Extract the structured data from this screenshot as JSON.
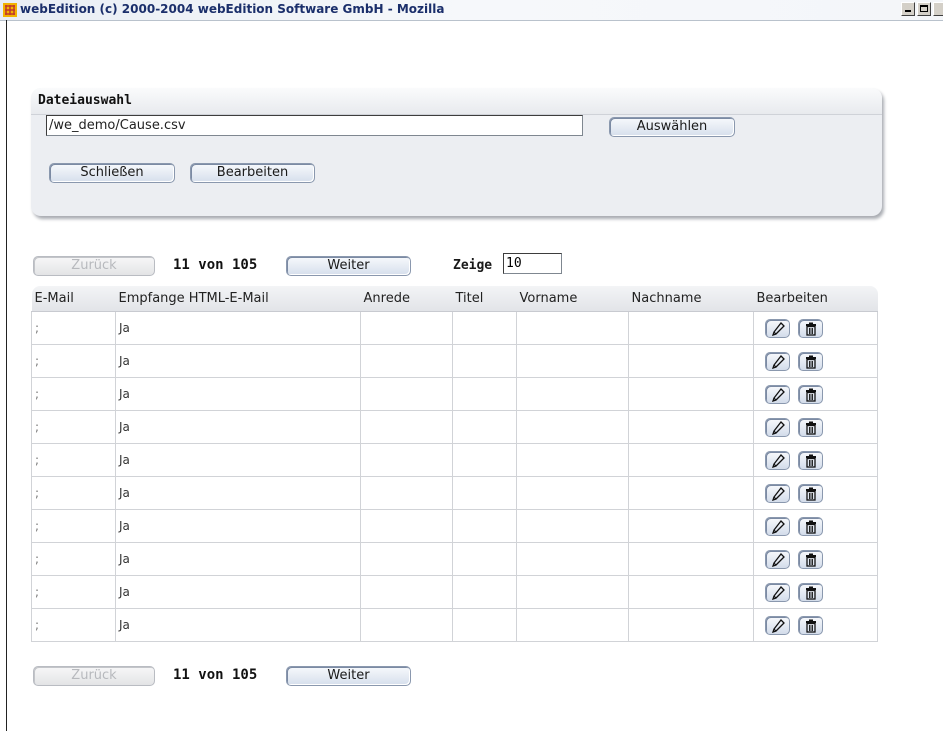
{
  "window": {
    "title": "webEdition (c) 2000-2004 webEdition Software GmbH - Mozilla",
    "app_icon": "webedition-logo-icon"
  },
  "file_selection": {
    "title": "Dateiauswahl",
    "path_value": "/we_demo/Cause.csv",
    "choose_label": "Auswählen",
    "close_label": "Schließen",
    "edit_label": "Bearbeiten"
  },
  "pager_top": {
    "prev_label": "Zurück",
    "count_text": "11 von 105",
    "next_label": "Weiter",
    "show_label": "Zeige",
    "show_value": "10"
  },
  "pager_bottom": {
    "prev_label": "Zurück",
    "count_text": "11 von 105",
    "next_label": "Weiter"
  },
  "table": {
    "columns": [
      "E-Mail",
      "Empfange HTML-E-Mail",
      "Anrede",
      "Titel",
      "Vorname",
      "Nachname",
      "Bearbeiten"
    ],
    "rows": [
      {
        "email": ";",
        "html": "Ja",
        "anrede": "",
        "titel": "",
        "vorname": "",
        "nachname": ""
      },
      {
        "email": ";",
        "html": "Ja",
        "anrede": "",
        "titel": "",
        "vorname": "",
        "nachname": ""
      },
      {
        "email": ";",
        "html": "Ja",
        "anrede": "",
        "titel": "",
        "vorname": "",
        "nachname": ""
      },
      {
        "email": ";",
        "html": "Ja",
        "anrede": "",
        "titel": "",
        "vorname": "",
        "nachname": ""
      },
      {
        "email": ";",
        "html": "Ja",
        "anrede": "",
        "titel": "",
        "vorname": "",
        "nachname": ""
      },
      {
        "email": ";",
        "html": "Ja",
        "anrede": "",
        "titel": "",
        "vorname": "",
        "nachname": ""
      },
      {
        "email": ";",
        "html": "Ja",
        "anrede": "",
        "titel": "",
        "vorname": "",
        "nachname": ""
      },
      {
        "email": ";",
        "html": "Ja",
        "anrede": "",
        "titel": "",
        "vorname": "",
        "nachname": ""
      },
      {
        "email": ";",
        "html": "Ja",
        "anrede": "",
        "titel": "",
        "vorname": "",
        "nachname": ""
      },
      {
        "email": ";",
        "html": "Ja",
        "anrede": "",
        "titel": "",
        "vorname": "",
        "nachname": ""
      }
    ],
    "row_icons": [
      "pencil-icon",
      "trash-icon"
    ]
  }
}
